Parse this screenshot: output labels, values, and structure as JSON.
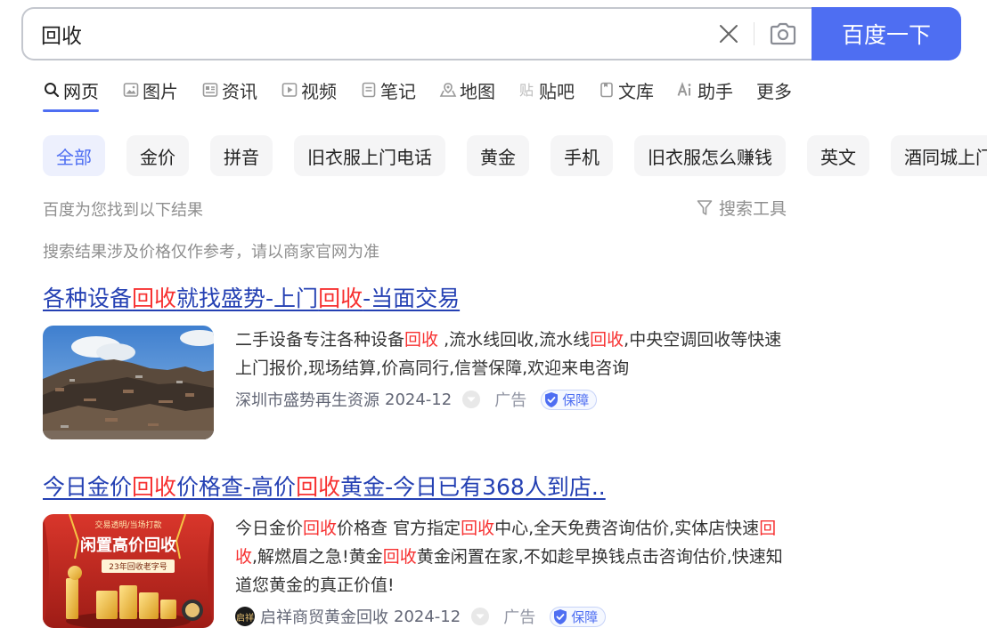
{
  "search": {
    "query": "回收",
    "submit_label": "百度一下"
  },
  "tabs": [
    {
      "label": "网页",
      "icon": "search-icon",
      "active": true
    },
    {
      "label": "图片",
      "icon": "image-icon"
    },
    {
      "label": "资讯",
      "icon": "news-icon"
    },
    {
      "label": "视频",
      "icon": "video-icon"
    },
    {
      "label": "笔记",
      "icon": "note-icon"
    },
    {
      "label": "地图",
      "icon": "map-icon"
    },
    {
      "label": "贴吧",
      "icon": "tieba-icon"
    },
    {
      "label": "文库",
      "icon": "library-icon"
    },
    {
      "label": "助手",
      "icon": "ai-icon"
    },
    {
      "label": "更多"
    }
  ],
  "chips": [
    "全部",
    "金价",
    "拼音",
    "旧衣服上门电话",
    "黄金",
    "手机",
    "旧衣服怎么赚钱",
    "英文",
    "酒同城上门回收"
  ],
  "info": {
    "found_text": "百度为您找到以下结果",
    "tools_label": "搜索工具",
    "notice": "搜索结果涉及价格仅作参考，请以商家官网为准"
  },
  "results": [
    {
      "title": {
        "p1": "各种设备",
        "h1": "回收",
        "p2": "就找盛势-上门",
        "h2": "回收",
        "p3": "-当面交易"
      },
      "snippet": {
        "p1": "二手设备专注各种设备",
        "h1": "回收",
        "p2": " ,流水线回收,流水线",
        "h2": "回收",
        "p3": ",中央空调回收等快速上门报价,现场结算,价高同行,信誉保障,欢迎来电咨询"
      },
      "source": "深圳市盛势再生资源",
      "date": "2024-12",
      "ad_label": "广告",
      "badge": "保障"
    },
    {
      "title": {
        "p1": "今日金价",
        "h1": "回收",
        "p2": "价格查-高价",
        "h2": "回收",
        "p3": "黄金-今日已有368人到店.."
      },
      "snippet": {
        "p1": "今日金价",
        "h1": "回收",
        "p2": "价格查 官方指定",
        "h2": "回收",
        "p3": "中心,全天免费咨询估价,实体店快速",
        "h3": "回收",
        "p4": ",解燃眉之急!黄金",
        "h4": "回收",
        "p5": "黄金闲置在家,不如趁早换钱点击咨询估价,快速知道您黄金的真正价值!"
      },
      "thumb": {
        "top_text": "交易透明/当场打款",
        "main_text": "闲置高价回收",
        "sub_text": "23年回收老字号"
      },
      "source_logo_text": "启祥",
      "source": "启祥商贸黄金回收",
      "date": "2024-12",
      "ad_label": "广告",
      "badge": "保障"
    }
  ],
  "colors": {
    "accent": "#4e6ef2",
    "link": "#2440b3",
    "highlight": "#f73131"
  }
}
